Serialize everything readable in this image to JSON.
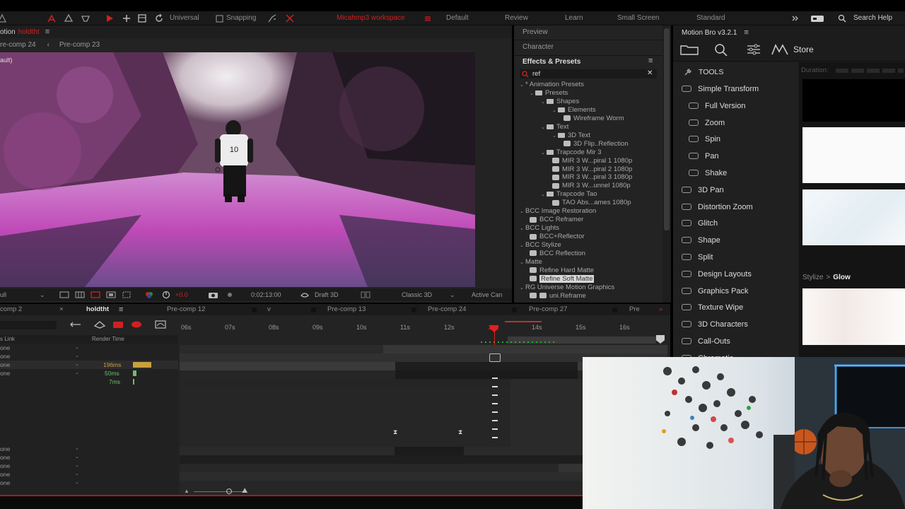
{
  "topbar": {
    "workspace_left": "Universal",
    "snapping": "Snapping",
    "workspace_red": "Micahmp3 workspace",
    "tabs": [
      "Default",
      "Review",
      "Learn",
      "Small Screen",
      "Standard"
    ],
    "search": "Search Help"
  },
  "comp": {
    "title_prefix": "otion",
    "title": "holdtht",
    "breadcrumb": [
      "re-comp 24",
      "Pre-comp 23"
    ],
    "corner_label": "ault)",
    "viewer_bar": {
      "zoom": "ull",
      "exposure": "+0.0",
      "timecode": "0:02:13:00",
      "draft": "Draft 3D",
      "renderer": "Classic 3D",
      "camera": "Active Can"
    }
  },
  "effects_panel": {
    "preview": "Preview",
    "character": "Character",
    "title": "Effects & Presets",
    "search_value": "ref",
    "tree": [
      {
        "label": "* Animation Presets",
        "indent": 0,
        "kind": "group"
      },
      {
        "label": "Presets",
        "indent": 1,
        "kind": "folder"
      },
      {
        "label": "Shapes",
        "indent": 2,
        "kind": "folder"
      },
      {
        "label": "Elements",
        "indent": 3,
        "kind": "folder"
      },
      {
        "label": "Wireframe Worm",
        "indent": 4,
        "kind": "preset"
      },
      {
        "label": "Text",
        "indent": 2,
        "kind": "folder"
      },
      {
        "label": "3D Text",
        "indent": 3,
        "kind": "folder"
      },
      {
        "label": "3D Flip..Reflection",
        "indent": 4,
        "kind": "preset"
      },
      {
        "label": "Trapcode Mir 3",
        "indent": 2,
        "kind": "folder"
      },
      {
        "label": "MIR 3 W...piral 1 1080p",
        "indent": 3,
        "kind": "preset"
      },
      {
        "label": "MIR 3 W...piral 2 1080p",
        "indent": 3,
        "kind": "preset"
      },
      {
        "label": "MIR 3 W...piral 3 1080p",
        "indent": 3,
        "kind": "preset"
      },
      {
        "label": "MIR 3 W...unnel 1080p",
        "indent": 3,
        "kind": "preset"
      },
      {
        "label": "Trapcode Tao",
        "indent": 2,
        "kind": "folder"
      },
      {
        "label": "TAO Abs...ames 1080p",
        "indent": 3,
        "kind": "preset"
      },
      {
        "label": "BCC Image Restoration",
        "indent": 0,
        "kind": "group"
      },
      {
        "label": "BCC Reframer",
        "indent": 1,
        "kind": "preset"
      },
      {
        "label": "BCC Lights",
        "indent": 0,
        "kind": "group"
      },
      {
        "label": "BCC+Reflector",
        "indent": 1,
        "kind": "preset"
      },
      {
        "label": "BCC Stylize",
        "indent": 0,
        "kind": "group"
      },
      {
        "label": "BCC Reflection",
        "indent": 1,
        "kind": "preset"
      },
      {
        "label": "Matte",
        "indent": 0,
        "kind": "group"
      },
      {
        "label": "Refine Hard Matte",
        "indent": 1,
        "kind": "preset"
      },
      {
        "label": "Refine Soft Matte",
        "indent": 1,
        "kind": "preset",
        "selected": true
      },
      {
        "label": "RG Universe Motion Graphics",
        "indent": 0,
        "kind": "group"
      },
      {
        "label": "uni.Reframe",
        "indent": 1,
        "kind": "preset2"
      }
    ]
  },
  "motionbro": {
    "title": "Motion Bro v3.2.1",
    "store": "Store",
    "tools_label": "TOOLS",
    "duration_label": "Duration:",
    "breadcrumb_parent": "Stylize",
    "breadcrumb_sep": ">",
    "breadcrumb_current": "Glow",
    "items": [
      {
        "label": "Simple Transform",
        "sub": false
      },
      {
        "label": "Full Version",
        "sub": true
      },
      {
        "label": "Zoom",
        "sub": true
      },
      {
        "label": "Spin",
        "sub": true
      },
      {
        "label": "Pan",
        "sub": true
      },
      {
        "label": "Shake",
        "sub": true
      },
      {
        "label": "3D Pan",
        "sub": false
      },
      {
        "label": "Distortion Zoom",
        "sub": false
      },
      {
        "label": "Glitch",
        "sub": false
      },
      {
        "label": "Shape",
        "sub": false
      },
      {
        "label": "Split",
        "sub": false
      },
      {
        "label": "Design Layouts",
        "sub": false
      },
      {
        "label": "Graphics Pack",
        "sub": false
      },
      {
        "label": "Texture Wipe",
        "sub": false
      },
      {
        "label": "3D Characters",
        "sub": false
      },
      {
        "label": "Call-Outs",
        "sub": false
      },
      {
        "label": "Chromatic",
        "sub": false
      }
    ]
  },
  "timeline": {
    "tabs": [
      "comp 2",
      "holdtht",
      "Pre-comp 12",
      "v",
      "Pre-comp 13",
      "Pre-comp 24",
      "Pre-comp 27",
      "Pre"
    ],
    "ruler": [
      "06s",
      "07s",
      "08s",
      "09s",
      "10s",
      "11s",
      "12s",
      "13s",
      "14s",
      "15s",
      "16s"
    ],
    "col_link": "s Link",
    "col_render": "Render Time",
    "rows_top": [
      "one",
      "one",
      "one",
      "one"
    ],
    "render_times": [
      "196ms",
      "50ms",
      "7ms"
    ],
    "rows_bottom": [
      "one",
      "one",
      "one",
      "one",
      "one"
    ]
  },
  "colors": {
    "accent_red": "#d02020",
    "render_bar": "#c8a040",
    "render_green": "#6bbf6b",
    "selection": "#d8d8d8"
  }
}
